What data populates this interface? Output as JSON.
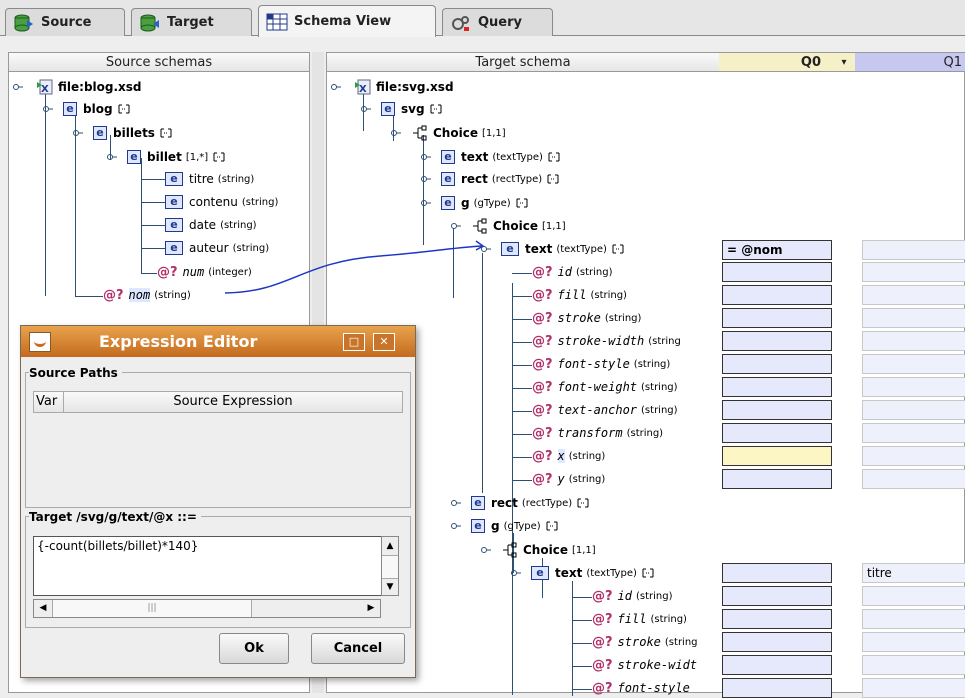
{
  "tabs": [
    {
      "label": "Source",
      "icon": "database-icon"
    },
    {
      "label": "Target",
      "icon": "database-icon"
    },
    {
      "label": "Schema View",
      "icon": "grid-icon",
      "active": true
    },
    {
      "label": "Query",
      "icon": "query-icon"
    }
  ],
  "source": {
    "header": "Source schemas",
    "file": "file:blog.xsd",
    "nodes": {
      "blog": "blog",
      "billets": "billets",
      "billet": "billet",
      "billet_card": "[1,*]",
      "titre": "titre",
      "titre_t": "(string)",
      "contenu": "contenu",
      "contenu_t": "(string)",
      "date": "date",
      "date_t": "(string)",
      "auteur": "auteur",
      "auteur_t": "(string)",
      "num": "num",
      "num_t": "(integer)",
      "nom": "nom",
      "nom_t": "(string)"
    }
  },
  "target": {
    "header": "Target schema",
    "q0": "Q0",
    "q1": "Q1",
    "file": "file:svg.xsd",
    "svg": "svg",
    "choice": "Choice",
    "card": "[1,1]",
    "text": "text",
    "textType": "(textType)",
    "rect": "rect",
    "rectType": "(rectType)",
    "g": "g",
    "gType": "(gType)",
    "attrs1": [
      "id",
      "fill",
      "stroke",
      "stroke-width",
      "font-style",
      "font-weight",
      "text-anchor",
      "transform",
      "x",
      "y"
    ],
    "attrs1_t": [
      "(string)",
      "(string)",
      "(string)",
      "(string",
      "(string)",
      "(string)",
      "(string)",
      "(string)",
      "(string)",
      "(string)"
    ],
    "attrs2": [
      "id",
      "fill",
      "stroke",
      "stroke-widt",
      "font-style"
    ],
    "attrs2_t": [
      "(string)",
      "(string)",
      "(string",
      "",
      ""
    ],
    "q0_text": "= @nom",
    "q1_text": "titre"
  },
  "dialog": {
    "title": "Expression Editor",
    "source_paths": "Source Paths",
    "col_var": "Var",
    "col_expr": "Source Expression",
    "target_label": "Target /svg/g/text/@x ::=",
    "expression": "{-count(billets/billet)*140}",
    "ok": "Ok",
    "cancel": "Cancel"
  },
  "colors": {
    "accent": "#c46a1f",
    "cell": "#e6e8fb",
    "highlight": "#fcf6c4",
    "link": "#1f35c8"
  }
}
